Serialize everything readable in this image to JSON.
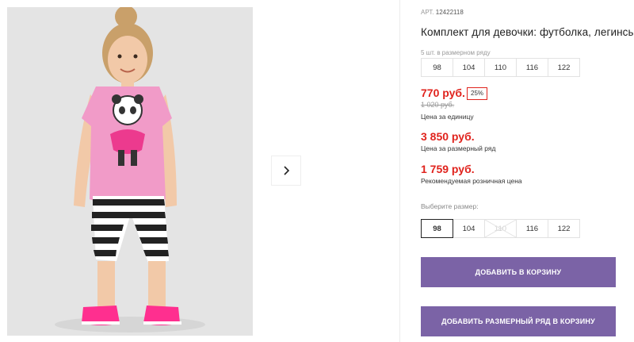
{
  "product": {
    "sku_label": "АРТ.",
    "sku_code": "12422118",
    "title": "Комплект для девочки: футболка, легинсы",
    "row_caption": "5 шт. в размерном ряду",
    "row_sizes": [
      "98",
      "104",
      "110",
      "116",
      "122"
    ]
  },
  "pricing": {
    "price": "770 руб.",
    "discount": "25%",
    "old_price": "1 020 руб.",
    "unit_caption": "Цена за единицу",
    "row_price": "3 850 руб.",
    "row_caption": "Цена за размерный ряд",
    "rrp_price": "1 759 руб.",
    "rrp_caption": "Рекомендуемая розничная цена",
    "color_accent": "#e0231d"
  },
  "size_picker": {
    "label": "Выберите размер:",
    "sizes": [
      {
        "label": "98",
        "state": "selected"
      },
      {
        "label": "104",
        "state": "available"
      },
      {
        "label": "110",
        "state": "disabled"
      },
      {
        "label": "116",
        "state": "available"
      },
      {
        "label": "122",
        "state": "available"
      }
    ]
  },
  "actions": {
    "add_to_cart": "ДОБАВИТЬ В КОРЗИНУ",
    "add_row_to_cart": "ДОБАВИТЬ РАЗМЕРНЫЙ РЯД В КОРЗИНУ",
    "button_color": "#7b63a6"
  },
  "gallery": {
    "next_icon": "chevron-right-icon"
  }
}
